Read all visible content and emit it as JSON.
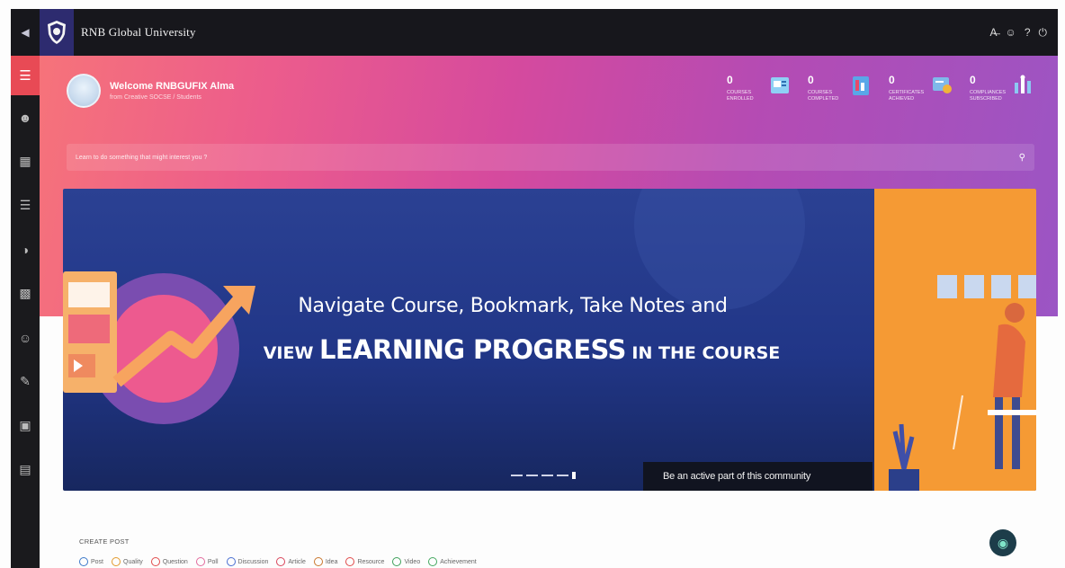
{
  "header": {
    "brand": "RNB Global University",
    "menu_toggle_icon": "chevron-left-icon",
    "actions": [
      "A̶",
      "☺",
      "?",
      "⏻"
    ]
  },
  "sidebar": {
    "items": [
      "menu-icon",
      "user-icon",
      "calendar-icon",
      "book-icon",
      "chart-icon",
      "grid-icon",
      "users-icon",
      "edit-icon",
      "save-icon",
      "report-icon"
    ]
  },
  "welcome": {
    "title": "Welcome RNBGUFIX Alma",
    "subtitle": "from Creative SOCSE / Students"
  },
  "stats": [
    {
      "value": "0",
      "label": "COURSES ENROLLED"
    },
    {
      "value": "0",
      "label": "COURSES COMPLETED"
    },
    {
      "value": "0",
      "label": "CERTIFICATES ACHIEVED"
    },
    {
      "value": "0",
      "label": "COMPLIANCES SUBSCRIBED"
    }
  ],
  "search": {
    "placeholder": "Learn to do something that might interest you ?"
  },
  "banner": {
    "line1": "Navigate Course, Bookmark, Take Notes and",
    "line2_prefix": "VIEW ",
    "line2_main": "LEARNING PROGRESS",
    "line2_suffix": " IN THE COURSE",
    "community": "Be an active part of this community",
    "slides": 5,
    "active_slide": 5
  },
  "create_post": {
    "label": "CREATE POST",
    "options": [
      {
        "label": "Post",
        "color": "#3b78c9"
      },
      {
        "label": "Quality",
        "color": "#e39a2d"
      },
      {
        "label": "Question",
        "color": "#e14b4b"
      },
      {
        "label": "Poll",
        "color": "#e26b9d"
      },
      {
        "label": "Discussion",
        "color": "#4a6fd1"
      },
      {
        "label": "Article",
        "color": "#d9455b"
      },
      {
        "label": "Idea",
        "color": "#c9762c"
      },
      {
        "label": "Resource",
        "color": "#e04a4a"
      },
      {
        "label": "Video",
        "color": "#3da05a"
      },
      {
        "label": "Achievement",
        "color": "#43a85f"
      }
    ]
  },
  "colors": {
    "topbar": "#17171c",
    "sidebar_active": "#e84a55",
    "hero_start": "#f6737a",
    "hero_end": "#9b55c4",
    "banner_blue": "#2b4193",
    "banner_orange": "#f59a34"
  }
}
